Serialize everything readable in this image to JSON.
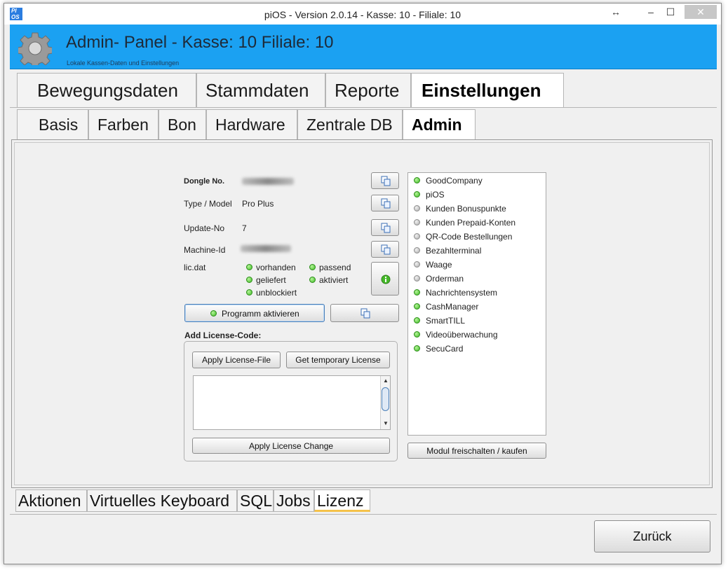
{
  "window": {
    "title": "piOS -  Version 2.0.14 - Kasse: 10 - Filiale: 10",
    "app_icon_text": "PI OS",
    "controls": {
      "resize": "↔",
      "minimize": "–",
      "maximize": "☐",
      "close": "✕"
    }
  },
  "header": {
    "title": "Admin- Panel - Kasse: 10 Filiale: 10",
    "subtitle": "Lokale Kassen-Daten und Einstellungen",
    "icon": "gear-icon",
    "accent_color": "#1ba1f2"
  },
  "main_tabs": [
    {
      "label": "Bewegungsdaten",
      "active": false
    },
    {
      "label": "Stammdaten",
      "active": false
    },
    {
      "label": "Reporte",
      "active": false
    },
    {
      "label": "Einstellungen",
      "active": true
    }
  ],
  "sub_tabs": [
    {
      "label": "Basis",
      "active": false
    },
    {
      "label": "Farben",
      "active": false
    },
    {
      "label": "Bon",
      "active": false
    },
    {
      "label": "Hardware",
      "active": false
    },
    {
      "label": "Zentrale DB",
      "active": false
    },
    {
      "label": "Admin",
      "active": true
    }
  ],
  "license": {
    "dongle_label": "Dongle No.",
    "type_label": "Type / Model",
    "type_value": "Pro Plus",
    "update_label": "Update-No",
    "update_value": "7",
    "machine_label": "Machine-Id",
    "licdat_label": "lic.dat",
    "licdat_status": [
      {
        "label": "vorhanden",
        "state": "green"
      },
      {
        "label": "passend",
        "state": "green"
      },
      {
        "label": "geliefert",
        "state": "green"
      },
      {
        "label": "aktiviert",
        "state": "green"
      },
      {
        "label": "unblockiert",
        "state": "green"
      }
    ],
    "activate_button": "Programm aktivieren",
    "add_code_label": "Add License-Code:",
    "apply_file_button": "Apply License-File",
    "temp_license_button": "Get temporary License",
    "textarea_value": "",
    "apply_change_button": "Apply License Change"
  },
  "modules": {
    "items": [
      {
        "label": "GoodCompany",
        "state": "green"
      },
      {
        "label": "piOS",
        "state": "green"
      },
      {
        "label": "Kunden Bonuspunkte",
        "state": "gray"
      },
      {
        "label": "Kunden Prepaid-Konten",
        "state": "gray"
      },
      {
        "label": "QR-Code Bestellungen",
        "state": "gray"
      },
      {
        "label": "Bezahlterminal",
        "state": "gray"
      },
      {
        "label": "Waage",
        "state": "gray"
      },
      {
        "label": "Orderman",
        "state": "gray"
      },
      {
        "label": "Nachrichtensystem",
        "state": "green"
      },
      {
        "label": "CashManager",
        "state": "green"
      },
      {
        "label": "SmartTILL",
        "state": "green"
      },
      {
        "label": "Videoüberwachung",
        "state": "green"
      },
      {
        "label": "SecuCard",
        "state": "green"
      }
    ],
    "unlock_button": "Modul freischalten / kaufen"
  },
  "bottom_tabs": [
    {
      "label": "Aktionen",
      "active": false
    },
    {
      "label": "Virtuelles Keyboard",
      "active": false
    },
    {
      "label": "SQL",
      "active": false
    },
    {
      "label": "Jobs",
      "active": false
    },
    {
      "label": "Lizenz",
      "active": true
    }
  ],
  "footer": {
    "back_button": "Zurück"
  }
}
